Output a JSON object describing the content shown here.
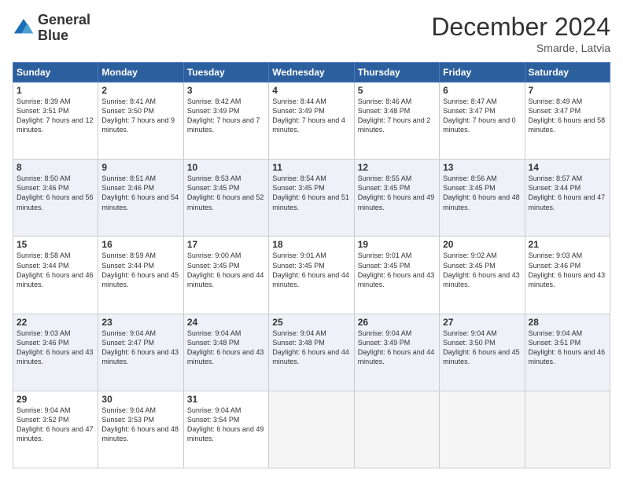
{
  "header": {
    "logo_line1": "General",
    "logo_line2": "Blue",
    "month": "December 2024",
    "location": "Smarde, Latvia"
  },
  "days_of_week": [
    "Sunday",
    "Monday",
    "Tuesday",
    "Wednesday",
    "Thursday",
    "Friday",
    "Saturday"
  ],
  "weeks": [
    [
      {
        "day": "1",
        "sunrise": "8:39 AM",
        "sunset": "3:51 PM",
        "daylight": "7 hours and 12 minutes."
      },
      {
        "day": "2",
        "sunrise": "8:41 AM",
        "sunset": "3:50 PM",
        "daylight": "7 hours and 9 minutes."
      },
      {
        "day": "3",
        "sunrise": "8:42 AM",
        "sunset": "3:49 PM",
        "daylight": "7 hours and 7 minutes."
      },
      {
        "day": "4",
        "sunrise": "8:44 AM",
        "sunset": "3:49 PM",
        "daylight": "7 hours and 4 minutes."
      },
      {
        "day": "5",
        "sunrise": "8:46 AM",
        "sunset": "3:48 PM",
        "daylight": "7 hours and 2 minutes."
      },
      {
        "day": "6",
        "sunrise": "8:47 AM",
        "sunset": "3:47 PM",
        "daylight": "7 hours and 0 minutes."
      },
      {
        "day": "7",
        "sunrise": "8:49 AM",
        "sunset": "3:47 PM",
        "daylight": "6 hours and 58 minutes."
      }
    ],
    [
      {
        "day": "8",
        "sunrise": "8:50 AM",
        "sunset": "3:46 PM",
        "daylight": "6 hours and 56 minutes."
      },
      {
        "day": "9",
        "sunrise": "8:51 AM",
        "sunset": "3:46 PM",
        "daylight": "6 hours and 54 minutes."
      },
      {
        "day": "10",
        "sunrise": "8:53 AM",
        "sunset": "3:45 PM",
        "daylight": "6 hours and 52 minutes."
      },
      {
        "day": "11",
        "sunrise": "8:54 AM",
        "sunset": "3:45 PM",
        "daylight": "6 hours and 51 minutes."
      },
      {
        "day": "12",
        "sunrise": "8:55 AM",
        "sunset": "3:45 PM",
        "daylight": "6 hours and 49 minutes."
      },
      {
        "day": "13",
        "sunrise": "8:56 AM",
        "sunset": "3:45 PM",
        "daylight": "6 hours and 48 minutes."
      },
      {
        "day": "14",
        "sunrise": "8:57 AM",
        "sunset": "3:44 PM",
        "daylight": "6 hours and 47 minutes."
      }
    ],
    [
      {
        "day": "15",
        "sunrise": "8:58 AM",
        "sunset": "3:44 PM",
        "daylight": "6 hours and 46 minutes."
      },
      {
        "day": "16",
        "sunrise": "8:59 AM",
        "sunset": "3:44 PM",
        "daylight": "6 hours and 45 minutes."
      },
      {
        "day": "17",
        "sunrise": "9:00 AM",
        "sunset": "3:45 PM",
        "daylight": "6 hours and 44 minutes."
      },
      {
        "day": "18",
        "sunrise": "9:01 AM",
        "sunset": "3:45 PM",
        "daylight": "6 hours and 44 minutes."
      },
      {
        "day": "19",
        "sunrise": "9:01 AM",
        "sunset": "3:45 PM",
        "daylight": "6 hours and 43 minutes."
      },
      {
        "day": "20",
        "sunrise": "9:02 AM",
        "sunset": "3:45 PM",
        "daylight": "6 hours and 43 minutes."
      },
      {
        "day": "21",
        "sunrise": "9:03 AM",
        "sunset": "3:46 PM",
        "daylight": "6 hours and 43 minutes."
      }
    ],
    [
      {
        "day": "22",
        "sunrise": "9:03 AM",
        "sunset": "3:46 PM",
        "daylight": "6 hours and 43 minutes."
      },
      {
        "day": "23",
        "sunrise": "9:04 AM",
        "sunset": "3:47 PM",
        "daylight": "6 hours and 43 minutes."
      },
      {
        "day": "24",
        "sunrise": "9:04 AM",
        "sunset": "3:48 PM",
        "daylight": "6 hours and 43 minutes."
      },
      {
        "day": "25",
        "sunrise": "9:04 AM",
        "sunset": "3:48 PM",
        "daylight": "6 hours and 44 minutes."
      },
      {
        "day": "26",
        "sunrise": "9:04 AM",
        "sunset": "3:49 PM",
        "daylight": "6 hours and 44 minutes."
      },
      {
        "day": "27",
        "sunrise": "9:04 AM",
        "sunset": "3:50 PM",
        "daylight": "6 hours and 45 minutes."
      },
      {
        "day": "28",
        "sunrise": "9:04 AM",
        "sunset": "3:51 PM",
        "daylight": "6 hours and 46 minutes."
      }
    ],
    [
      {
        "day": "29",
        "sunrise": "9:04 AM",
        "sunset": "3:52 PM",
        "daylight": "6 hours and 47 minutes."
      },
      {
        "day": "30",
        "sunrise": "9:04 AM",
        "sunset": "3:53 PM",
        "daylight": "6 hours and 48 minutes."
      },
      {
        "day": "31",
        "sunrise": "9:04 AM",
        "sunset": "3:54 PM",
        "daylight": "6 hours and 49 minutes."
      },
      null,
      null,
      null,
      null
    ]
  ]
}
